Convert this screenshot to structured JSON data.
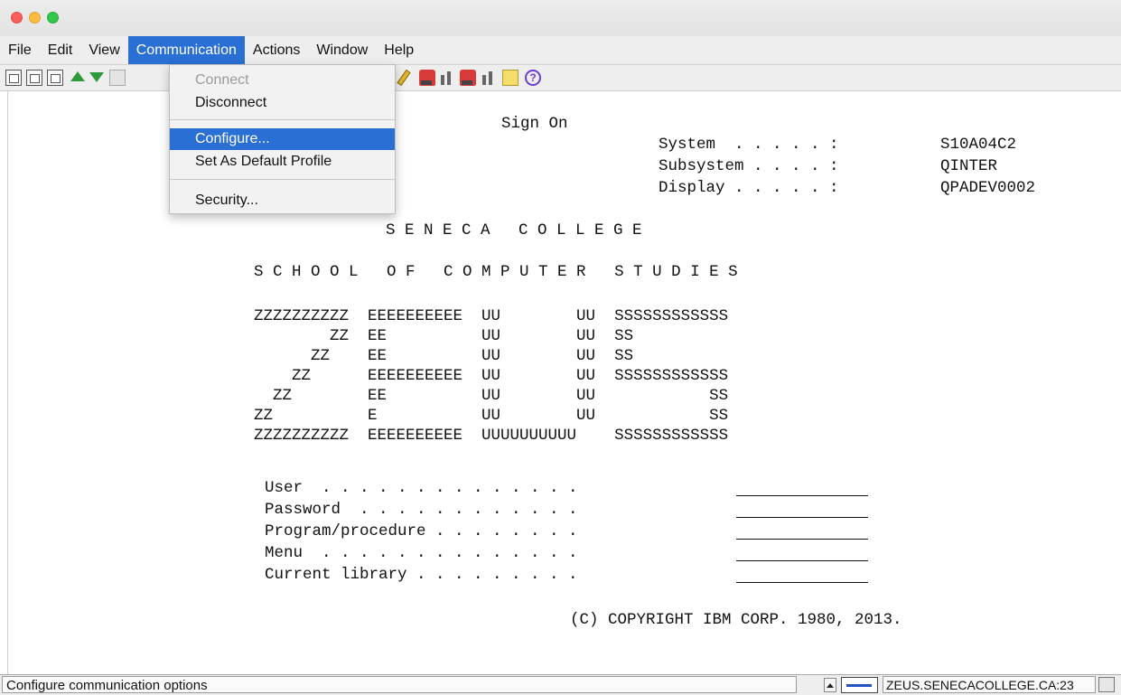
{
  "menubar": {
    "items": [
      "File",
      "Edit",
      "View",
      "Communication",
      "Actions",
      "Window",
      "Help"
    ],
    "active": "Communication"
  },
  "toolbar": {
    "icons": [
      "print-screen-icon",
      "copy-icon",
      "paste-icon",
      "send-file-icon",
      "receive-file-icon",
      "display-icon",
      "macro-icon",
      "record-macro-icon",
      "stop-macro-icon",
      "play-macro-icon",
      "pause-macro-icon",
      "notes-icon",
      "help-icon"
    ]
  },
  "dropdown": {
    "connect": "Connect",
    "disconnect": "Disconnect",
    "configure": "Configure...",
    "set_default": "Set As Default Profile",
    "security": "Security..."
  },
  "screen": {
    "title": "Sign On",
    "system_label": "System  . . . . . :",
    "system_value": "S10A04C2",
    "subsystem_label": "Subsystem . . . . :",
    "subsystem_value": "QINTER",
    "display_label": "Display . . . . . :",
    "display_value": "QPADEV0002",
    "banner1": "S E N E C A   C O L L E G E",
    "banner2": "S C H O O L   O F   C O M P U T E R   S T U D I E S",
    "art": [
      "ZZZZZZZZZZ  EEEEEEEEEE  UU        UU  SSSSSSSSSSSS",
      "        ZZ  EE          UU        UU  SS",
      "      ZZ    EE          UU        UU  SS",
      "    ZZ      EEEEEEEEEE  UU        UU  SSSSSSSSSSSS",
      "  ZZ        EE          UU        UU            SS",
      "ZZ          E           UU        UU            SS",
      "ZZZZZZZZZZ  EEEEEEEEEE  UUUUUUUUUU    SSSSSSSSSSSS"
    ],
    "fields": [
      "User  . . . . . . . . . . . . . .",
      "Password  . . . . . . . . . . . .",
      "Program/procedure . . . . . . . .",
      "Menu  . . . . . . . . . . . . . .",
      "Current library . . . . . . . . ."
    ],
    "copyright": "(C) COPYRIGHT IBM CORP. 1980, 2013."
  },
  "status": {
    "message": "Configure communication options",
    "host": "ZEUS.SENECACOLLEGE.CA:23"
  }
}
